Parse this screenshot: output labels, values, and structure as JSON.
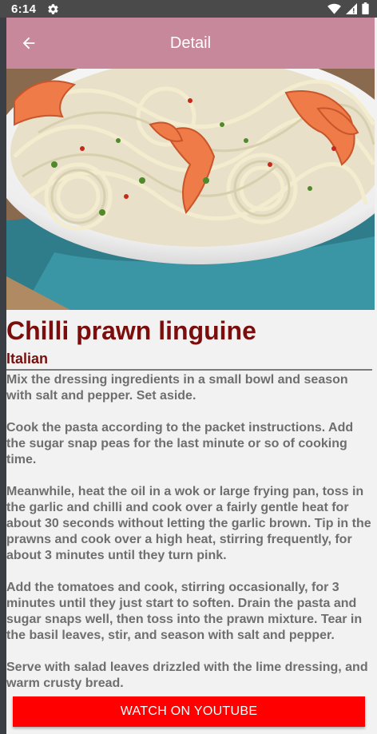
{
  "status_bar": {
    "time": "6:14",
    "left_icons": [
      "gear-icon"
    ],
    "right_icons": [
      "wifi-icon",
      "signal-icon",
      "battery-icon"
    ]
  },
  "app_bar": {
    "title": "Detail",
    "back_icon": "arrow-left-icon",
    "color": "#c8889c"
  },
  "recipe": {
    "title": "Chilli prawn linguine",
    "cuisine": "Italian",
    "instructions": "Mix the dressing ingredients in a small bowl and season with salt and pepper. Set aside.\n\nCook the pasta according to the packet instructions. Add the sugar snap peas for the last minute or so of cooking time.\n\nMeanwhile, heat the oil in a wok or large frying pan, toss in the garlic and chilli and cook over a fairly gentle heat for about 30 seconds without letting the garlic brown. Tip in the prawns and cook over a high heat, stirring frequently, for about 3 minutes until they turn pink.\n\nAdd the tomatoes and cook, stirring occasionally, for 3 minutes until they just start to soften. Drain the pasta and sugar snaps well, then toss into the prawn mixture. Tear in the basil leaves, stir, and season with salt and pepper.\n\nServe with salad leaves drizzled with the lime dressing, and warm crusty bread.",
    "title_color": "#7b0d0d"
  },
  "actions": {
    "youtube_label": "WATCH ON YOUTUBE",
    "youtube_color": "#ff0000"
  }
}
